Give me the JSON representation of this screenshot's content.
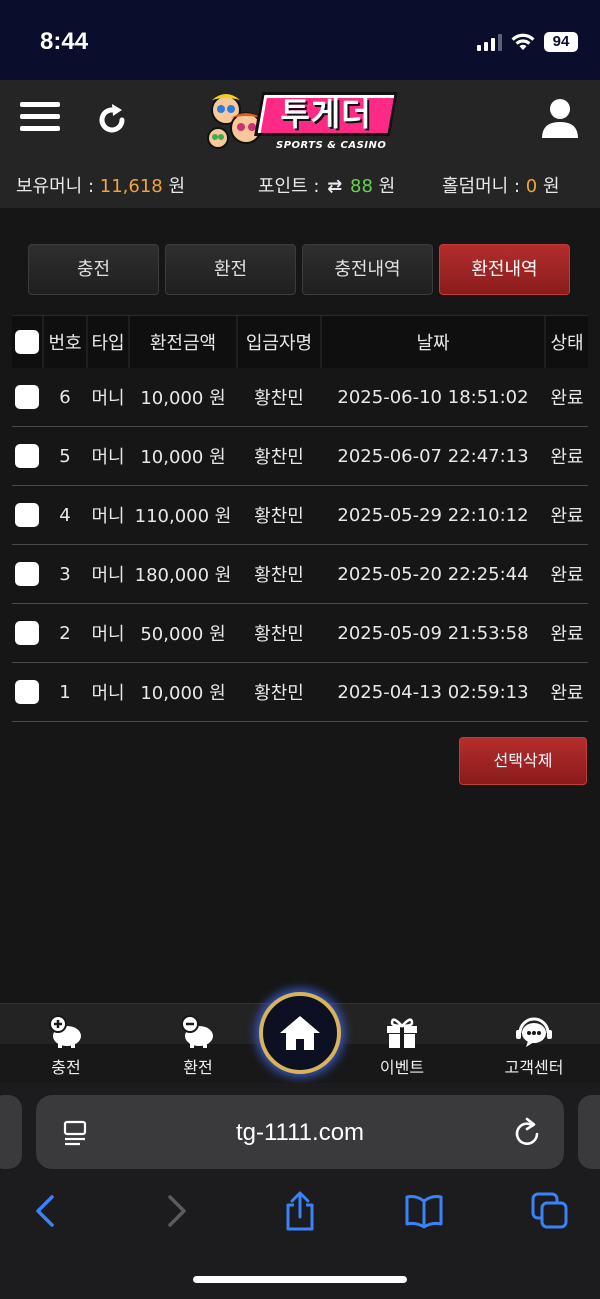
{
  "status": {
    "time": "8:44",
    "battery": "94"
  },
  "site": {
    "logo_text": "투게더",
    "logo_sub": "SPORTS & CASINO"
  },
  "balances": {
    "holding_label": "보유머니 :",
    "holding_value": "11,618",
    "holding_unit": "원",
    "points_label": "포인트 :",
    "points_value": "88",
    "points_unit": "원",
    "holdem_label": "홀덤머니 :",
    "holdem_value": "0",
    "holdem_unit": "원"
  },
  "tabs": [
    {
      "label": "충전",
      "active": false
    },
    {
      "label": "환전",
      "active": false
    },
    {
      "label": "충전내역",
      "active": false
    },
    {
      "label": "환전내역",
      "active": true
    }
  ],
  "table": {
    "headers": [
      "번호",
      "타입",
      "환전금액",
      "입금자명",
      "날짜",
      "상태"
    ],
    "rows": [
      {
        "no": "6",
        "type": "머니",
        "amount": "10,000 원",
        "name": "황찬민",
        "date": "2025-06-10 18:51:02",
        "status": "완료"
      },
      {
        "no": "5",
        "type": "머니",
        "amount": "10,000 원",
        "name": "황찬민",
        "date": "2025-06-07 22:47:13",
        "status": "완료"
      },
      {
        "no": "4",
        "type": "머니",
        "amount": "110,000 원",
        "name": "황찬민",
        "date": "2025-05-29 22:10:12",
        "status": "완료"
      },
      {
        "no": "3",
        "type": "머니",
        "amount": "180,000 원",
        "name": "황찬민",
        "date": "2025-05-20 22:25:44",
        "status": "완료"
      },
      {
        "no": "2",
        "type": "머니",
        "amount": "50,000 원",
        "name": "황찬민",
        "date": "2025-05-09 21:53:58",
        "status": "완료"
      },
      {
        "no": "1",
        "type": "머니",
        "amount": "10,000 원",
        "name": "황찬민",
        "date": "2025-04-13 02:59:13",
        "status": "완료"
      }
    ]
  },
  "delete_button": "선택삭제",
  "bottom_nav": [
    {
      "label": "충전",
      "icon": "piggy-plus-icon"
    },
    {
      "label": "환전",
      "icon": "piggy-minus-icon"
    },
    {
      "label": "",
      "icon": "home-icon"
    },
    {
      "label": "이벤트",
      "icon": "gift-icon"
    },
    {
      "label": "고객센터",
      "icon": "headset-chat-icon"
    }
  ],
  "browser": {
    "url": "tg-1111.com"
  },
  "colors": {
    "accent_red": "#a52424",
    "amount_orange": "#f0a43a",
    "points_green": "#63d44b",
    "ios_blue": "#3a82f7"
  }
}
